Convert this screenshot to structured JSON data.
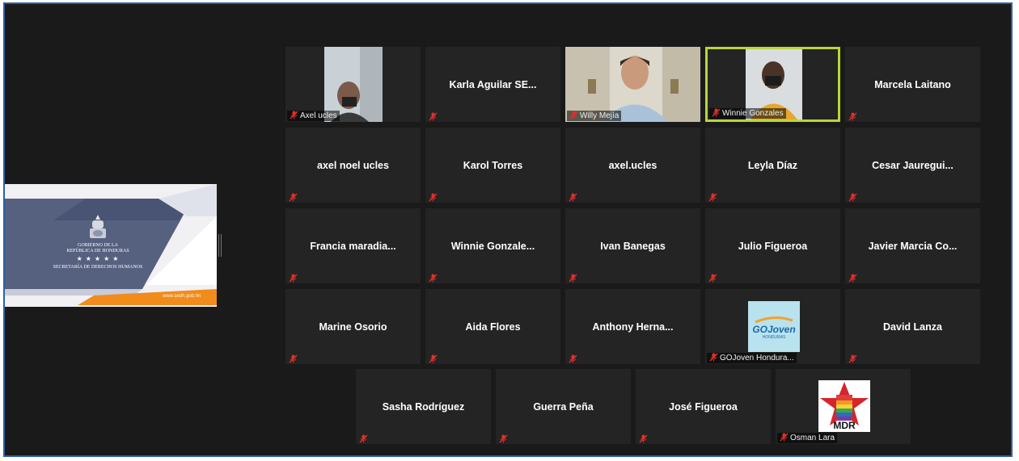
{
  "shared_screen": {
    "gov_line1": "GOBIERNO DE LA",
    "gov_line2": "REPÚBLICA DE HONDURAS",
    "stars": "★ ★ ★ ★ ★",
    "secretaria": "SECRETARÍA DE DERECHOS HUMANOS",
    "url": "www.sedh.gob.hn"
  },
  "participants": [
    {
      "name": "Axel ucles",
      "video": true
    },
    {
      "name": "Karla  Aguilar  SE..."
    },
    {
      "name": "Willy Mejía",
      "video": true
    },
    {
      "name": "Winnie Gonzales",
      "video": true,
      "active": true
    },
    {
      "name": "Marcela Laitano"
    },
    {
      "name": "axel noel ucles"
    },
    {
      "name": "Karol Torres"
    },
    {
      "name": "axel.ucles"
    },
    {
      "name": "Leyla Díaz"
    },
    {
      "name": "Cesar  Jauregui..."
    },
    {
      "name": "Francia  maradia..."
    },
    {
      "name": "Winnie  Gonzale..."
    },
    {
      "name": "Ivan Banegas"
    },
    {
      "name": "Julio Figueroa"
    },
    {
      "name": "Javier  Marcia  Co..."
    },
    {
      "name": "Marine Osorio"
    },
    {
      "name": "Aida Flores"
    },
    {
      "name": "Anthony  Herna..."
    },
    {
      "name": "GOJoven Hondura...",
      "logo_text": "GOJoven",
      "logo_sub": "HONDURAS"
    },
    {
      "name": "David Lanza"
    },
    {
      "name": "Sasha Rodríguez"
    },
    {
      "name": "Guerra Peña"
    },
    {
      "name": "José Figueroa"
    },
    {
      "name": "Osman Lara",
      "logo_text": "MDR"
    }
  ],
  "colors": {
    "window_border": "#2d5fa8",
    "active_speaker": "#b7d63a",
    "muted_icon": "#e0302a",
    "tile_bg": "#242424"
  },
  "icons": {
    "muted": "microphone-muted-icon"
  }
}
